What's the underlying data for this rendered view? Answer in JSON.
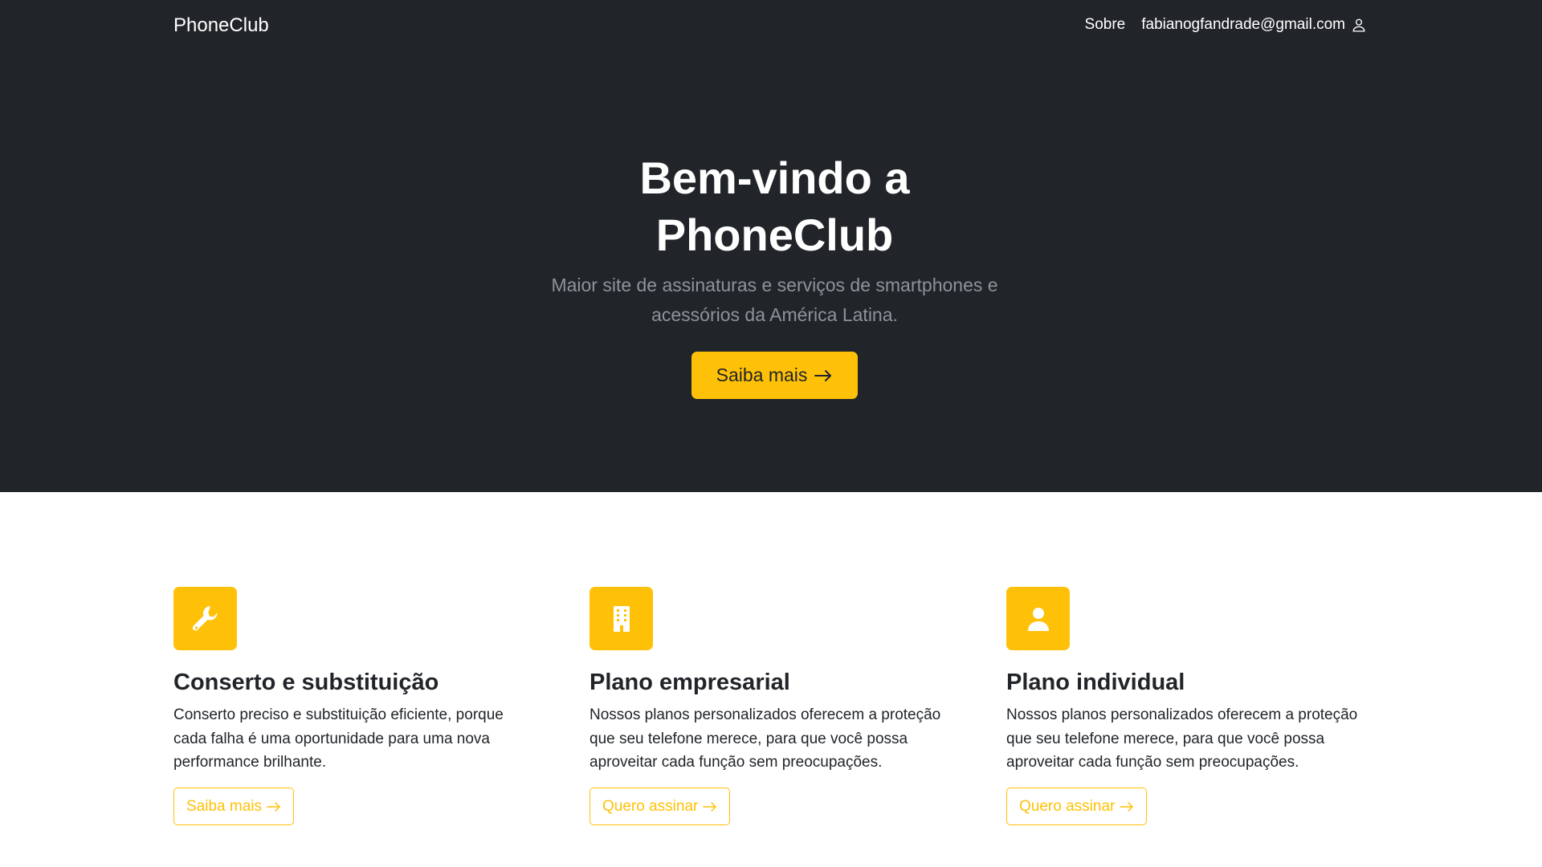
{
  "navbar": {
    "brand": "PhoneClub",
    "about_link": "Sobre",
    "user_email": "fabianogfandrade@gmail.com",
    "user_icon": "person-icon"
  },
  "hero": {
    "title_line1": "Bem-vindo a",
    "title_line2": "PhoneClub",
    "subtitle_line1": "Maior site de assinaturas e serviços de smartphones e",
    "subtitle_line2": "acessórios da América Latina.",
    "button_label": "Saiba mais",
    "button_icon": "arrow-right-icon"
  },
  "features": [
    {
      "icon": "wrench-icon",
      "title": "Conserto e substituição",
      "text_lines": [
        "Conserto preciso e substituição eficiente, porque",
        "cada falha é uma oportunidade para uma nova",
        "performance brilhante."
      ],
      "button_label": "Saiba mais"
    },
    {
      "icon": "building-icon",
      "title": "Plano empresarial",
      "text_lines": [
        "Nossos planos personalizados oferecem a proteção",
        "que seu telefone merece, para que você possa",
        "aproveitar cada função sem preocupações."
      ],
      "button_label": "Quero assinar"
    },
    {
      "icon": "person-fill-icon",
      "title": "Plano individual",
      "text_lines": [
        "Nossos planos personalizados oferecem a proteção",
        "que seu telefone merece, para que você possa",
        "aproveitar cada função sem preocupações."
      ],
      "button_label": "Quero assinar"
    }
  ],
  "colors": {
    "hero_background": "#212529",
    "accent": "#ffc107",
    "subtitle": "#8d9399",
    "text": "#212529"
  }
}
